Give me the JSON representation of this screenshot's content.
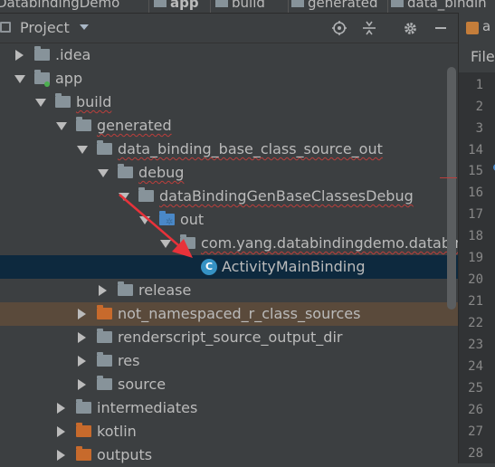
{
  "breadcrumbs": [
    "DatabindingDemo",
    "app",
    "build",
    "generated",
    "data_bindin"
  ],
  "project_panel": {
    "title": "Project",
    "tools": [
      "target-icon",
      "collapse-all-icon",
      "gear-icon",
      "minimize-icon"
    ]
  },
  "tree": [
    {
      "label": ".idea"
    },
    {
      "label": "app"
    },
    {
      "label": "build"
    },
    {
      "label": "generated"
    },
    {
      "label": "data_binding_base_class_source_out"
    },
    {
      "label": "debug"
    },
    {
      "label": "dataBindingGenBaseClassesDebug"
    },
    {
      "label": "out"
    },
    {
      "label": "com.yang.databindingdemo.databinding"
    },
    {
      "label": "ActivityMainBinding"
    },
    {
      "label": "release"
    },
    {
      "label": "not_namespaced_r_class_sources"
    },
    {
      "label": "renderscript_source_output_dir"
    },
    {
      "label": "res"
    },
    {
      "label": "source"
    },
    {
      "label": "intermediates"
    },
    {
      "label": "kotlin"
    },
    {
      "label": "outputs"
    }
  ],
  "editor": {
    "tab_label": "a",
    "files_label": "Files",
    "line_numbers": [
      "1",
      "2",
      "3",
      "14",
      "15",
      "16",
      "17",
      "18",
      "19",
      "20",
      "21",
      "22",
      "23",
      "24",
      "25",
      "26",
      "27",
      "28"
    ]
  },
  "colors": {
    "panel_bg": "#3c3f41",
    "selection": "#0d293e",
    "excluded_row": "#5a4a3b",
    "arrow_red": "#e8323a"
  }
}
